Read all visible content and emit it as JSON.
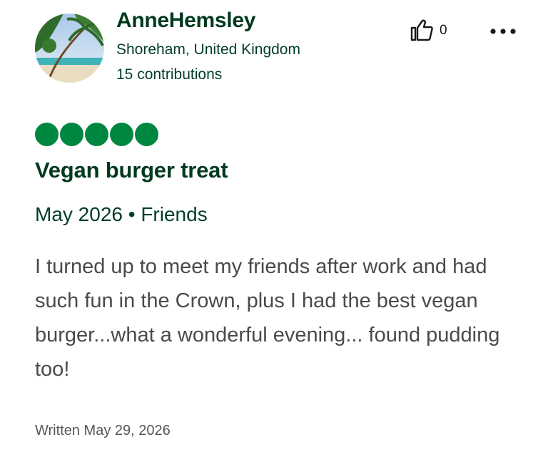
{
  "user": {
    "name": "AnneHemsley",
    "location": "Shoreham, United Kingdom",
    "contributions": "15 contributions"
  },
  "helpful": {
    "icon": "thumbs-up-icon",
    "count": "0"
  },
  "menu": {
    "icon": "more-horizontal-icon"
  },
  "rating": {
    "value": 5,
    "max": 5,
    "color": "#00873f"
  },
  "review": {
    "title": "Vegan burger treat",
    "trip_meta": "May 2026 • Friends",
    "body": "I turned up to meet my friends after work and had such fun in the Crown, plus I had the best vegan burger...what a wonderful evening... found pudding too!",
    "written": "Written May 29, 2026"
  },
  "colors": {
    "heading": "#00391f",
    "body_text": "#4a4a4a",
    "bubble": "#00873f"
  }
}
